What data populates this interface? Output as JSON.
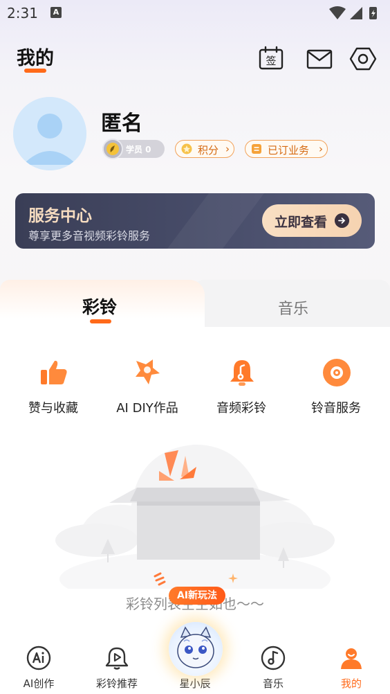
{
  "status_bar": {
    "time": "2:31",
    "notification_glyph": "A"
  },
  "header": {
    "title": "我的",
    "icons": [
      "checkin-icon",
      "mail-icon",
      "settings-icon"
    ],
    "checkin_glyph": "签"
  },
  "profile": {
    "name": "匿名",
    "level_label": "学员 0",
    "points_label": "积分",
    "subscriptions_label": "已订业务"
  },
  "service_center": {
    "title": "服务中心",
    "subtitle": "尊享更多音视频彩铃服务",
    "button_label": "立即查看"
  },
  "tabs": [
    {
      "label": "彩铃",
      "active": true
    },
    {
      "label": "音乐",
      "active": false
    }
  ],
  "quick_actions": [
    {
      "label": "赞与收藏",
      "icon": "thumbs-up-icon"
    },
    {
      "label": "AI DIY作品",
      "icon": "ai-diy-icon"
    },
    {
      "label": "音频彩铃",
      "icon": "bell-music-icon"
    },
    {
      "label": "铃音服务",
      "icon": "gear-service-icon"
    }
  ],
  "empty_state": {
    "text": "彩铃列表空空如也～～",
    "ai_badge": "AI新玩法"
  },
  "bottom_nav": [
    {
      "label": "AI创作",
      "icon": "ai-create-icon",
      "active": false
    },
    {
      "label": "彩铃推荐",
      "icon": "bell-recommend-icon",
      "active": false
    },
    {
      "label": "星小辰",
      "icon": "mascot-icon",
      "active": false
    },
    {
      "label": "音乐",
      "icon": "music-note-icon",
      "active": false
    },
    {
      "label": "我的",
      "icon": "profile-icon",
      "active": true
    }
  ],
  "colors": {
    "accent": "#ff6a1a",
    "banner_bg": "#484d6a",
    "banner_title": "#f6dcc0",
    "chip_border": "#f2a25a"
  }
}
